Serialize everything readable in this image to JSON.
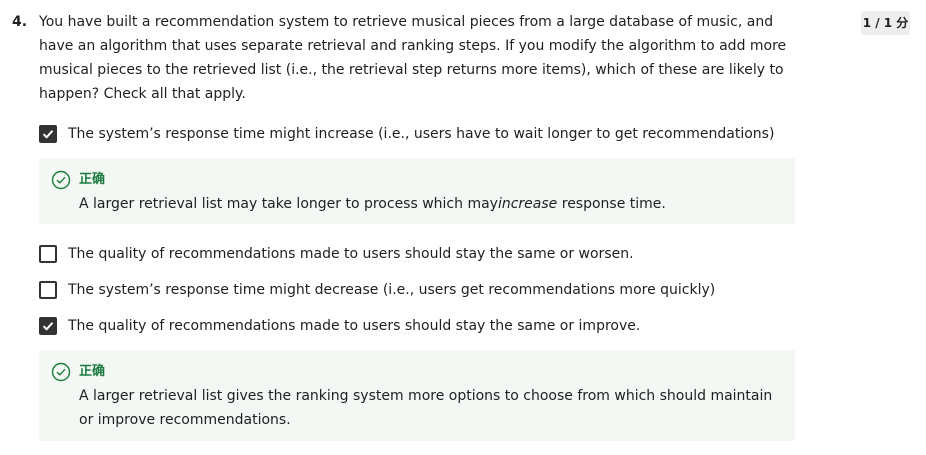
{
  "question": {
    "number": "4.",
    "text": "You have built a recommendation system to retrieve musical pieces from a large database of music, and have an algorithm that uses separate retrieval and ranking steps. If you modify the algorithm to add more musical pieces to the retrieved list (i.e., the retrieval step returns more items), which of these are likely to happen? Check all that apply.",
    "score": "1 / 1 分"
  },
  "options": [
    {
      "label": "The system’s response time might increase (i.e., users have to wait longer to get recommendations)",
      "checked": true,
      "feedback": {
        "status": "正确",
        "text_before": "A larger retrieval list may take longer to process which may",
        "text_emphasis": "increase",
        "text_after": " response time."
      }
    },
    {
      "label": "The quality of recommendations made to users should stay the same or worsen.",
      "checked": false
    },
    {
      "label": "The system’s response time might decrease (i.e., users get recommendations more quickly)",
      "checked": false
    },
    {
      "label": "The quality of recommendations made to users should stay the same or improve.",
      "checked": true,
      "feedback": {
        "status": "正确",
        "text": "A larger retrieval list gives the ranking system more options to choose from which should maintain or improve recommendations."
      }
    }
  ],
  "colors": {
    "correct_green": "#1d7b3f",
    "feedback_bg": "#f3f8f4",
    "checkbox_dark": "#333333",
    "badge_bg": "#eeeeee"
  },
  "icons": {
    "checked": "check-icon",
    "correct": "check-circle-icon"
  }
}
